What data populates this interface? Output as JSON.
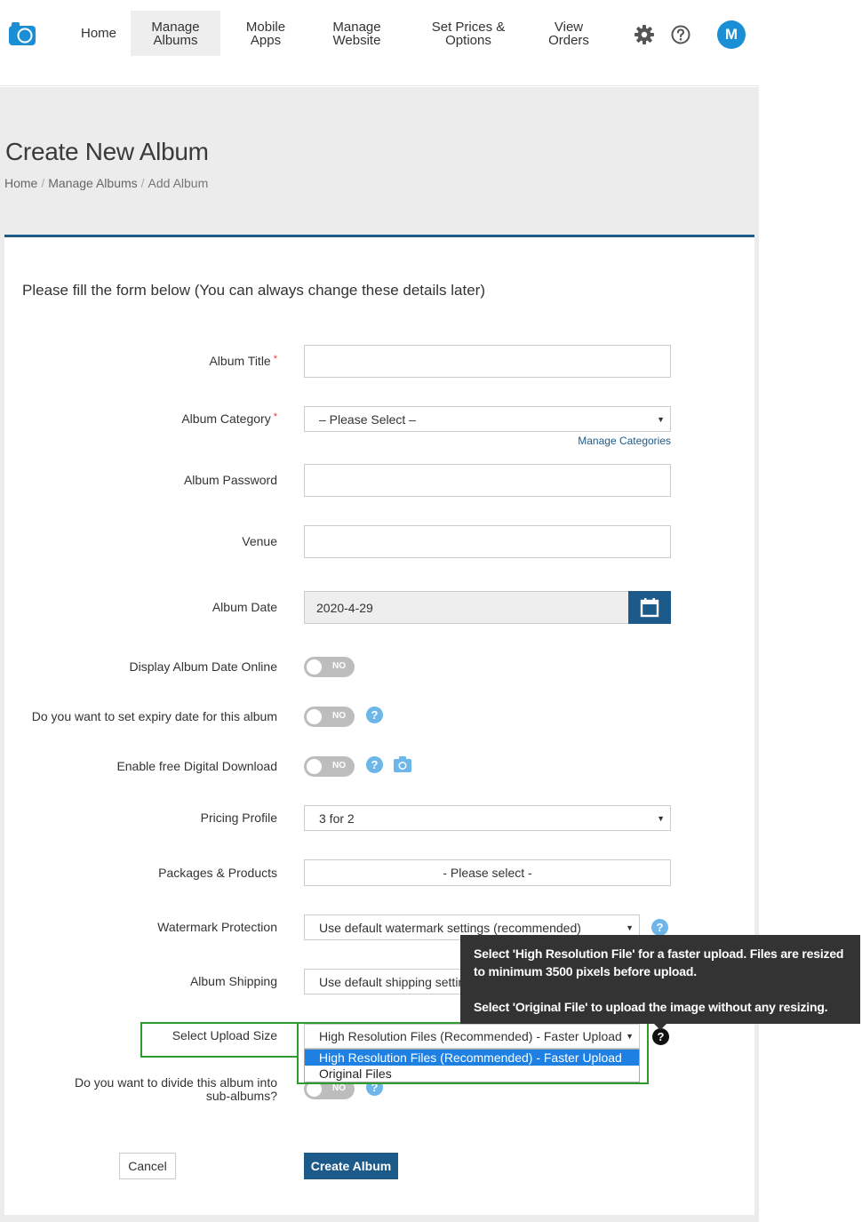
{
  "nav": {
    "items": [
      {
        "line1": "Home",
        "line2": ""
      },
      {
        "line1": "Manage",
        "line2": "Albums"
      },
      {
        "line1": "Mobile",
        "line2": "Apps"
      },
      {
        "line1": "Manage",
        "line2": "Website"
      },
      {
        "line1": "Set Prices &",
        "line2": "Options"
      },
      {
        "line1": "View",
        "line2": "Orders"
      }
    ],
    "avatar": "M",
    "icons": {
      "settings": "gear-icon",
      "help": "question-circle-icon",
      "logo": "camera-logo-icon"
    }
  },
  "header": {
    "title": "Create New Album",
    "breadcrumb": [
      "Home",
      "Manage Albums",
      "Add Album"
    ]
  },
  "form": {
    "intro": "Please fill the form below (You can always change these details later)",
    "album_title_label": "Album Title",
    "required_mark": "*",
    "album_category_label": "Album Category",
    "album_category_value": "– Please Select –",
    "manage_categories": "Manage Categories",
    "album_password_label": "Album Password",
    "venue_label": "Venue",
    "album_date_label": "Album Date",
    "album_date_value": "2020-4-29",
    "display_date_label": "Display Album Date Online",
    "expiry_label": "Do you want to set expiry date for this album",
    "free_download_label": "Enable free Digital Download",
    "toggle_no": "NO",
    "help_glyph": "?",
    "pricing_label": "Pricing Profile",
    "pricing_value": "3 for 2",
    "packages_label": "Packages & Products",
    "packages_value": "- Please select -",
    "watermark_label": "Watermark Protection",
    "watermark_value": "Use default watermark settings (recommended)",
    "shipping_label": "Album Shipping",
    "shipping_value": "Use default shipping settin",
    "upload_size_label": "Select Upload Size",
    "upload_size_value": "High Resolution Files (Recommended) - Faster Upload",
    "upload_options": [
      "High Resolution Files (Recommended) - Faster Upload",
      "Original Files"
    ],
    "sub_albums_label_1": "Do you want to divide this album into",
    "sub_albums_label_2": "sub-albums?",
    "cancel": "Cancel",
    "create": "Create Album"
  },
  "tooltip": {
    "line1": "Select 'High Resolution File' for a faster upload. Files are resized to minimum 3500 pixels before upload.",
    "line2": "Select 'Original File' to upload the image without any resizing."
  },
  "colors": {
    "brand": "#1c5a8a",
    "accent": "#1a8fd6",
    "highlight": "#2f9b2f",
    "help": "#6db6ea"
  }
}
